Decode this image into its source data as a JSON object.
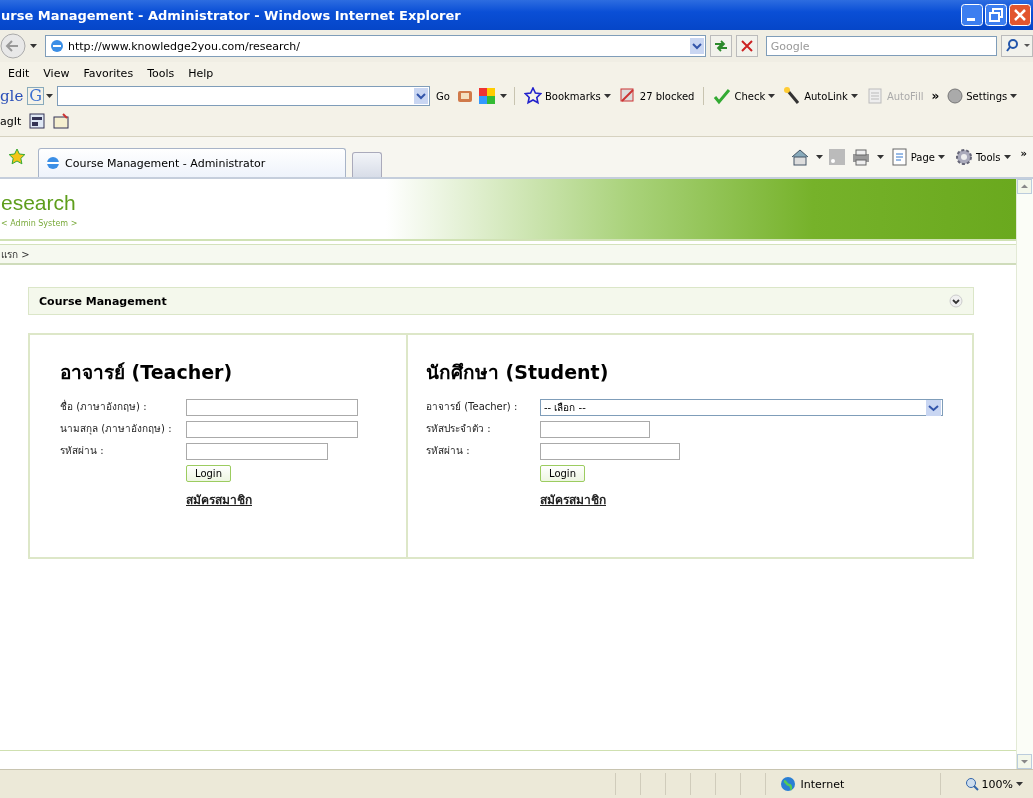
{
  "window": {
    "title": "urse Management - Administrator - Windows Internet Explorer"
  },
  "address_bar": {
    "url": "http://www.knowledge2you.com/research/"
  },
  "search": {
    "placeholder": "Google"
  },
  "menu": [
    "Edit",
    "View",
    "Favorites",
    "Tools",
    "Help"
  ],
  "google_toolbar": {
    "logo": "gle",
    "g_button": "G",
    "go": "Go",
    "items": [
      {
        "label": "Bookmarks",
        "disabled": false
      },
      {
        "label": "27 blocked",
        "disabled": false
      },
      {
        "label": "Check",
        "disabled": false
      },
      {
        "label": "AutoLink",
        "disabled": false
      },
      {
        "label": "AutoFill",
        "disabled": true
      }
    ],
    "more": "»",
    "settings": "Settings"
  },
  "links_bar": {
    "label": "agIt"
  },
  "tabs": [
    {
      "label": "Course Management - Administrator",
      "selected": true
    }
  ],
  "command_bar": {
    "page": "Page",
    "tools": "Tools",
    "more": "»"
  },
  "page": {
    "site_title": "esearch",
    "subtitle": "< Admin System >",
    "breadcrumb": "แรก >",
    "panel_title": "Course Management",
    "forms": [
      {
        "title": "อาจารย์ (Teacher)",
        "fields": [
          {
            "kind": "text",
            "label": "ชื่อ (ภาษาอังกฤษ) :"
          },
          {
            "kind": "text",
            "label": "นามสกุล (ภาษาอังกฤษ) :"
          },
          {
            "kind": "password",
            "label": "รหัสผ่าน :"
          }
        ],
        "button": "Login",
        "link": "สมัครสมาชิก"
      },
      {
        "title": "นักศึกษา (Student)",
        "fields": [
          {
            "kind": "select",
            "label": "อาจารย์ (Teacher) :",
            "value": "-- เลือก --"
          },
          {
            "kind": "text",
            "label": "รหัสประจำตัว :"
          },
          {
            "kind": "password",
            "label": "รหัสผ่าน :"
          }
        ],
        "button": "Login",
        "link": "สมัครสมาชิก"
      }
    ]
  },
  "status_bar": {
    "zone": "Internet",
    "zoom": "100%"
  }
}
